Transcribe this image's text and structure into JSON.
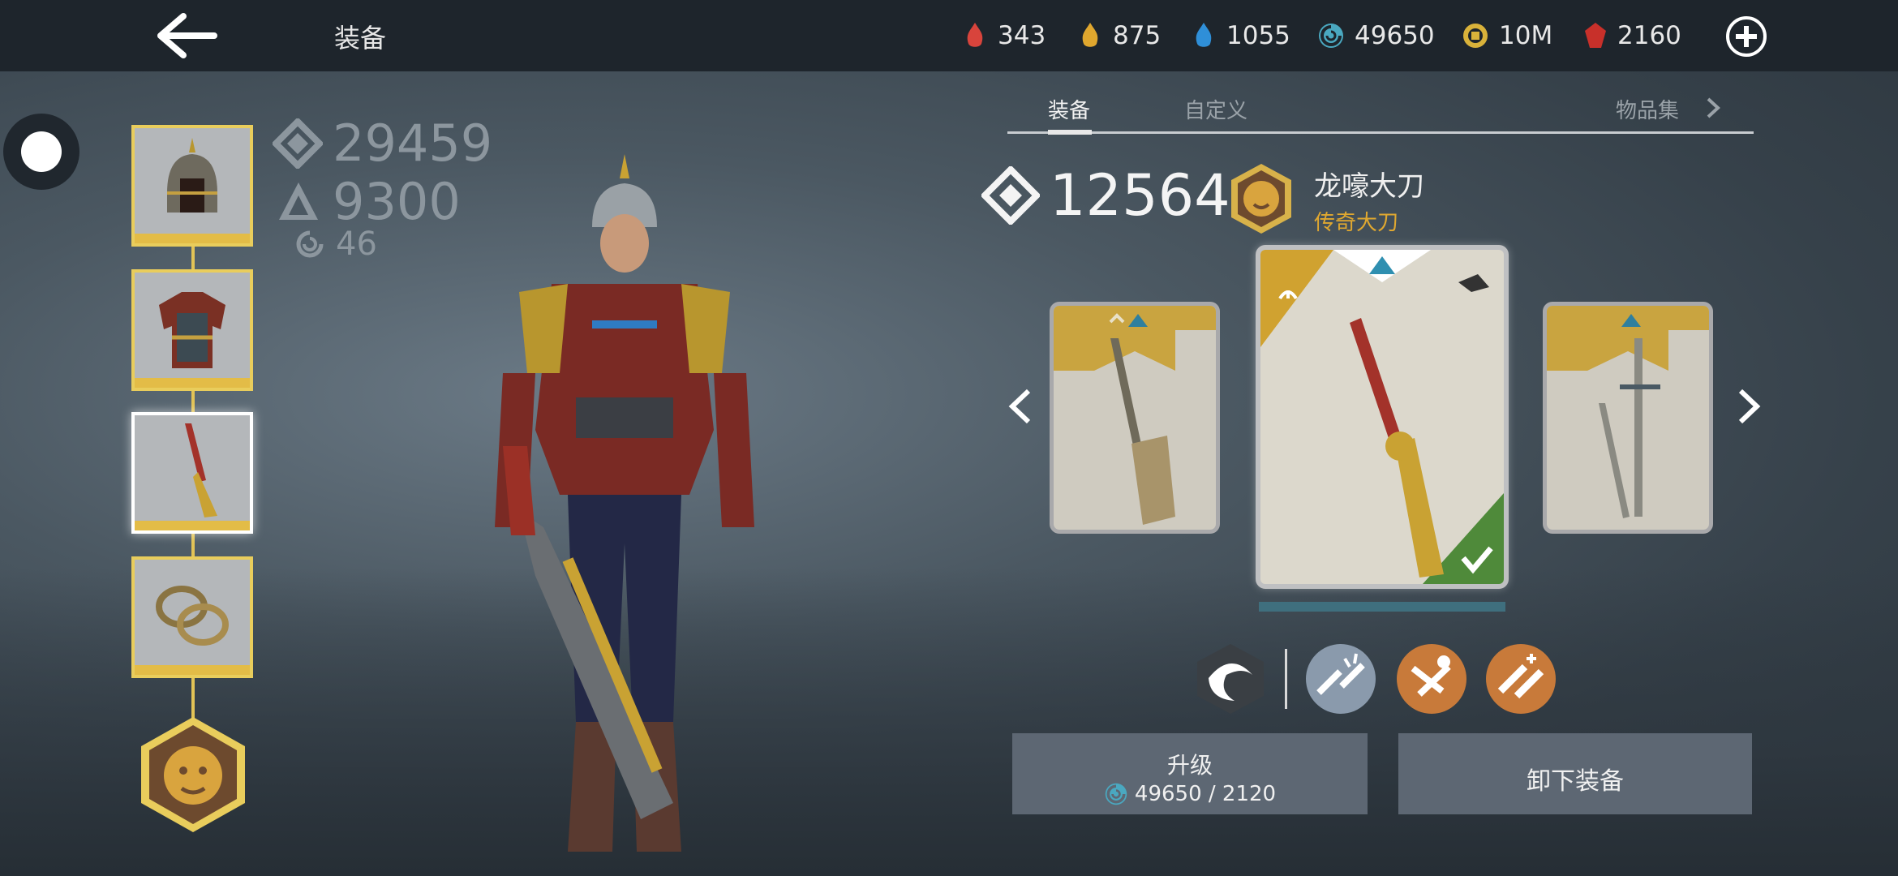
{
  "header": {
    "title": "装备",
    "currencies": [
      {
        "icon": "red-crystal-icon",
        "value": "343",
        "color": "#d8443c"
      },
      {
        "icon": "gold-crystal-icon",
        "value": "875",
        "color": "#e0a72e"
      },
      {
        "icon": "blue-crystal-icon",
        "value": "1055",
        "color": "#2f8fd8"
      },
      {
        "icon": "swirl-essence-icon",
        "value": "49650",
        "color": "#4aa8c0"
      },
      {
        "icon": "coin-icon",
        "value": "10M",
        "color": "#d9b23a"
      },
      {
        "icon": "ruby-icon",
        "value": "2160",
        "color": "#c8302a"
      }
    ]
  },
  "stats": {
    "total_power": "29459",
    "secondary": "9300",
    "essence": "46"
  },
  "tabs": {
    "equip": "装备",
    "custom": "自定义",
    "collection": "物品集"
  },
  "weapon": {
    "power": "12564",
    "name": "龙嚎大刀",
    "rarity": "传奇大刀"
  },
  "actions": {
    "upgrade_label": "升级",
    "upgrade_cost": "49650 / 2120",
    "unequip_label": "卸下装备"
  },
  "colors": {
    "accent_gold": "#e9cd5c",
    "legendary": "#e0a830",
    "equipped_green": "#4f8a3a",
    "skill_orange": "#c87a3a"
  }
}
